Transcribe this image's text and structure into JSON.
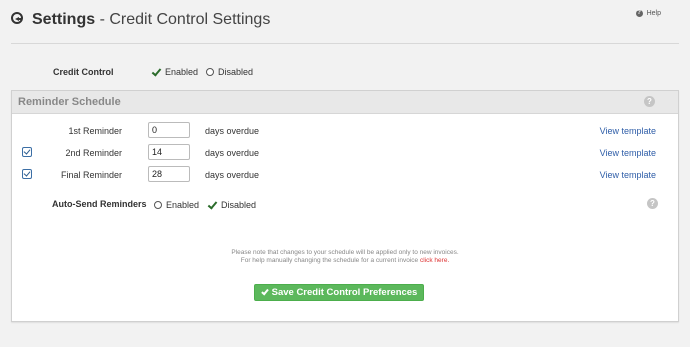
{
  "header": {
    "title": "Settings",
    "subtitle": "- Credit Control Settings",
    "help_label": "Help"
  },
  "credit_control": {
    "label": "Credit Control",
    "enabled_label": "Enabled",
    "disabled_label": "Disabled",
    "selected": "Enabled"
  },
  "panel": {
    "title": "Reminder Schedule"
  },
  "reminders": [
    {
      "label": "1st Reminder",
      "value": "0",
      "checked": false,
      "days_label": "days overdue",
      "view_label": "View template"
    },
    {
      "label": "2nd Reminder",
      "value": "14",
      "checked": true,
      "days_label": "days overdue",
      "view_label": "View template"
    },
    {
      "label": "Final Reminder",
      "value": "28",
      "checked": true,
      "days_label": "days overdue",
      "view_label": "View template"
    }
  ],
  "auto_send": {
    "label": "Auto-Send Reminders",
    "enabled_label": "Enabled",
    "disabled_label": "Disabled",
    "selected": "Disabled"
  },
  "note": {
    "line1": "Please note that changes to your schedule will be applied only to new invoices.",
    "line2_prefix": "For help manually changing the schedule for a current invoice",
    "link_text": "click here."
  },
  "save_button": {
    "label": "Save Credit Control Preferences"
  },
  "colors": {
    "accent_green": "#5cb85c",
    "link_blue": "#2f5ea8",
    "link_red": "#d33333"
  }
}
